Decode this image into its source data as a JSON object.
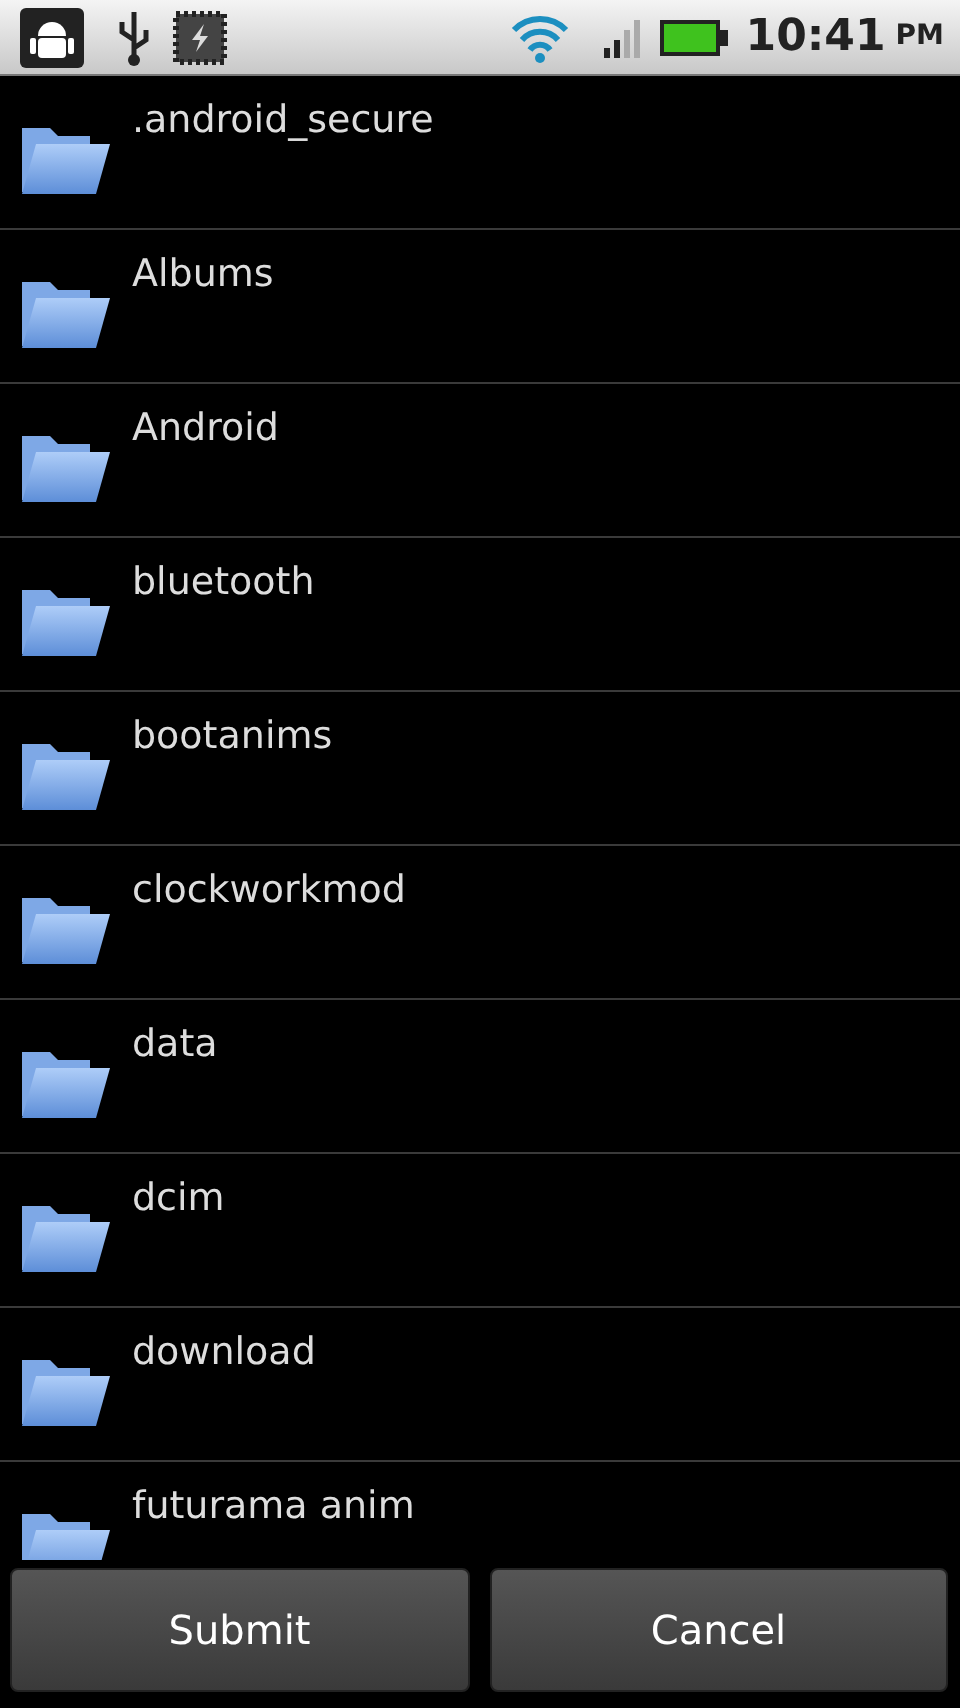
{
  "status_bar": {
    "time": "10:41",
    "meridiem": "PM"
  },
  "folders": [
    {
      "name": ".android_secure"
    },
    {
      "name": "Albums"
    },
    {
      "name": "Android"
    },
    {
      "name": "bluetooth"
    },
    {
      "name": "bootanims"
    },
    {
      "name": "clockworkmod"
    },
    {
      "name": "data"
    },
    {
      "name": "dcim"
    },
    {
      "name": "download"
    },
    {
      "name": "futurama anim"
    }
  ],
  "buttons": [
    {
      "label": "Submit"
    },
    {
      "label": "Cancel"
    }
  ]
}
